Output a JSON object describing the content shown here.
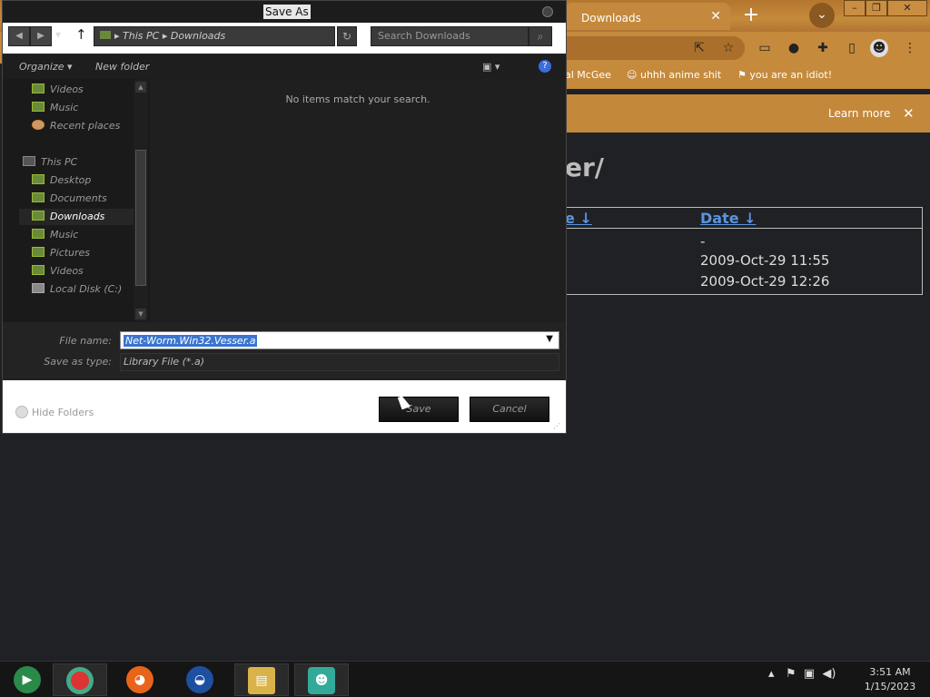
{
  "browser": {
    "tab_title": "Downloads",
    "tab_close": "✕",
    "new_tab": "+",
    "bookmarks": [
      "al McGee",
      "uhhh anime shit",
      "you are an idiot!"
    ],
    "infobar_learn_more": "Learn more",
    "infobar_close": "✕",
    "page_heading": "er/",
    "listing": {
      "col_name": "e",
      "col_date": "Date",
      "sort_marker": "↓",
      "dates": [
        "-",
        "2009-Oct-29 11:55",
        "2009-Oct-29 12:26"
      ]
    }
  },
  "dialog": {
    "title": "Save As",
    "breadcrumb": [
      "This PC",
      "Downloads"
    ],
    "search_placeholder": "Search Downloads",
    "organize": "Organize",
    "new_folder": "New folder",
    "nav_items": [
      {
        "label": "Videos"
      },
      {
        "label": "Music"
      },
      {
        "label": "Recent places"
      },
      {
        "label": "This PC"
      },
      {
        "label": "Desktop"
      },
      {
        "label": "Documents"
      },
      {
        "label": "Downloads"
      },
      {
        "label": "Music"
      },
      {
        "label": "Pictures"
      },
      {
        "label": "Videos"
      },
      {
        "label": "Local Disk (C:)"
      }
    ],
    "empty_message": "No items match your search.",
    "file_name_label": "File name:",
    "file_name_value": "Net-Worm.Win32.Vesser.a",
    "save_type_label": "Save as type:",
    "save_type_value": "Library File (*.a)",
    "hide_folders": "Hide Folders",
    "save": "Save",
    "cancel": "Cancel"
  },
  "taskbar": {
    "time": "3:51 AM",
    "date": "1/15/2023",
    "apps": [
      "media-center",
      "chrome",
      "firefox",
      "obama",
      "file-explorer",
      "network-people"
    ]
  },
  "colors": {
    "link": "#5a94e0",
    "selection": "#3a75d0",
    "chrome_theme": "#c58a3c"
  }
}
